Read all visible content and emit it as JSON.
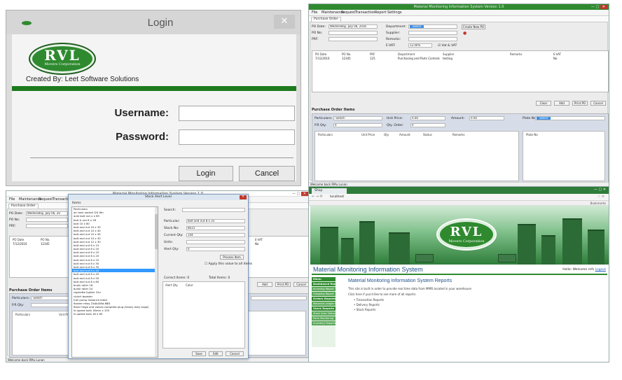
{
  "login": {
    "title": "Login",
    "close_glyph": "✕",
    "logo": "RVL",
    "logo_sub": "Movers Corporation",
    "credit": "Created By: Leet Software Solutions",
    "username_label": "Username:",
    "password_label": "Password:",
    "login_button": "Login",
    "cancel_button": "Cancel"
  },
  "app": {
    "title": "Material Monitoring Information System Version 1.0",
    "menu": [
      "File",
      "Maintenance",
      "Request",
      "Transaction",
      "Report",
      "Settings"
    ],
    "tab": "Purchase Order",
    "status": "Welcome back RMu Lunan",
    "window_controls": "— ▢",
    "close_glyph": "✕"
  },
  "po_window": {
    "po_date_label": "PO Date:",
    "po_date_value": "Wednesday,     July    06, 2016",
    "po_no_label": "PO No:",
    "prf_label": "PRF:",
    "department_label": "Department:",
    "department_value": "Select",
    "supplier_label": "Supplier:",
    "remarks_label": "Remarks:",
    "evat_label": "E-VAT:",
    "evat_value": "12.00%",
    "vat_check_label": "Vat & VAT",
    "create_button": "Create New PO",
    "grid_headers": [
      "PO Date",
      "PO No.",
      "PRF",
      "Department",
      "Supplier",
      "Remarks",
      "E-VAT"
    ],
    "grid_row": [
      "7/12/2016",
      "12345",
      "125",
      "Purchasing and Parts Controls",
      "testing",
      "",
      "No"
    ],
    "buttons": [
      "Clear",
      "Add",
      "Print PO",
      "Cancel"
    ],
    "items_section": "Purchase Order Items",
    "particulars_label": "Particulars:",
    "particulars_value": "-Select-",
    "unit_price_label": "Unit Price:",
    "unit_price_value": "0.00",
    "amount_label": "Amount:",
    "amount_value": "0.00",
    "pr_qty_label": "P.R Qty:",
    "pr_qty_value": "0",
    "qty_order_label": "Qty. Order:",
    "qty_order_value": "0",
    "plate_label": "Plate No:",
    "plate_value": "Select",
    "item_headers": [
      "Particulars",
      "Unit Price",
      "Qty",
      "Amount",
      "Status",
      "Remarks"
    ],
    "plate_header": "Plate No"
  },
  "stock_window": {
    "po_date_label": "PO Date:",
    "po_date_value": "Wednesday,     July    06, 20",
    "po_no_label": "PO No:",
    "prf_label": "PRF:",
    "grid_headers": [
      "PO Date",
      "PO No."
    ],
    "grid_row": [
      "7/12/2016",
      "12345"
    ],
    "evat_header": "E-VAT",
    "evat_value": "No",
    "buttons": [
      "Add",
      "Print PO",
      "Cancel"
    ],
    "items_section": "Purchase Order Items",
    "particulars_label": "Particulars:",
    "particulars_value": "-Select-",
    "pr_qty_label": "P.R Qty:",
    "item_headers": [
      "Particulars",
      "Unit Pr"
    ]
  },
  "stock_dialog": {
    "title": "Stock Alert Level",
    "items_label": "Items",
    "search_label": "Search:",
    "particular_label": "Particular:",
    "particular_value": "bolt and nut 8 x 35",
    "stock_no_label": "Stock No:",
    "stock_no_value": "BS15",
    "current_qty_label": "Current Qty:",
    "current_qty_value": "144",
    "units_label": "Units:",
    "alert_qty_label": "Alert Qty:",
    "alert_qty_value": "0",
    "process_button": "Process Item",
    "apply_all_label": "Apply this value to all items",
    "correct_items": "Correct Items: 0",
    "total_items": "Total Items: 0",
    "list_headers": [
      "Alert Qty",
      "Color"
    ],
    "footer_buttons": [
      "Save",
      "Edit",
      "Cancel"
    ],
    "items": [
      "Particulars",
      "air tank socket 3/4 fdn",
      "axle bolt nut x x 65",
      "bolt & nut 8 x 28",
      "bolt 10 x 60",
      "bolt and nut 10 x 35",
      "bolt and nut 10 x 40",
      "bolt and nut 10 x 45",
      "bolt and nut 10 x 30",
      "bolt and nut 12 x 30",
      "bolt and nut 6 x 15",
      "bolt and nut 6 x 20",
      "bolt and nut 6 x 25",
      "bolt and nut 8 x 20",
      "bolt and nut 8 x 25",
      "bolt and nut 8 x 30",
      "bolt and nut 8 x 35",
      "bolt and nut 8 x 40",
      "bolt and nut 8 x 45",
      "bolt and nut 8 x 50",
      "bolt and nut 8 x 60",
      "bushi roller 16",
      "bushi roller 24",
      "cigarette lighter 24v",
      "clutch booster",
      "fuel pump motor/re-kited",
      "flasher relay 24Ab/08d-68D",
      "flash hinge and valves complete plug (heavy duty large)",
      "hi-speed bulb 16mm x 105",
      "hi-speed bulb 18 x 65"
    ],
    "selected_index": 17
  },
  "browser": {
    "tab_label": "Shop",
    "url": "localhost",
    "bookmarks": "Bookmarks",
    "logo": "RVL",
    "logo_sub": "Movers Corporation",
    "site_title": "Material Monitoring Information System",
    "user_text": "Hello: Welcome rnfs",
    "logout": "Logout",
    "sidebar": [
      {
        "head": "Menu",
        "items": []
      },
      {
        "head": "Dashboard Reports",
        "items": [
          "Incoming Report",
          "Outgoing Report"
        ]
      },
      {
        "head": "Orders Reports",
        "items": [
          "Materials Ledger Reports"
        ]
      },
      {
        "head": "Stock Reports",
        "items": [
          "Stock Area Status",
          "Parts Monitoring",
          "Inventory Reports"
        ]
      }
    ],
    "main_title": "Material Monitoring Information System Reports",
    "main_line1": "This site is built in order to provide real time data from MMIS located in your warehouse",
    "main_line2": "Click here if you'd like to see more of all reports:",
    "bullets": [
      "Transaction Reports",
      "Delivery Reports",
      "Stock Reports"
    ]
  }
}
